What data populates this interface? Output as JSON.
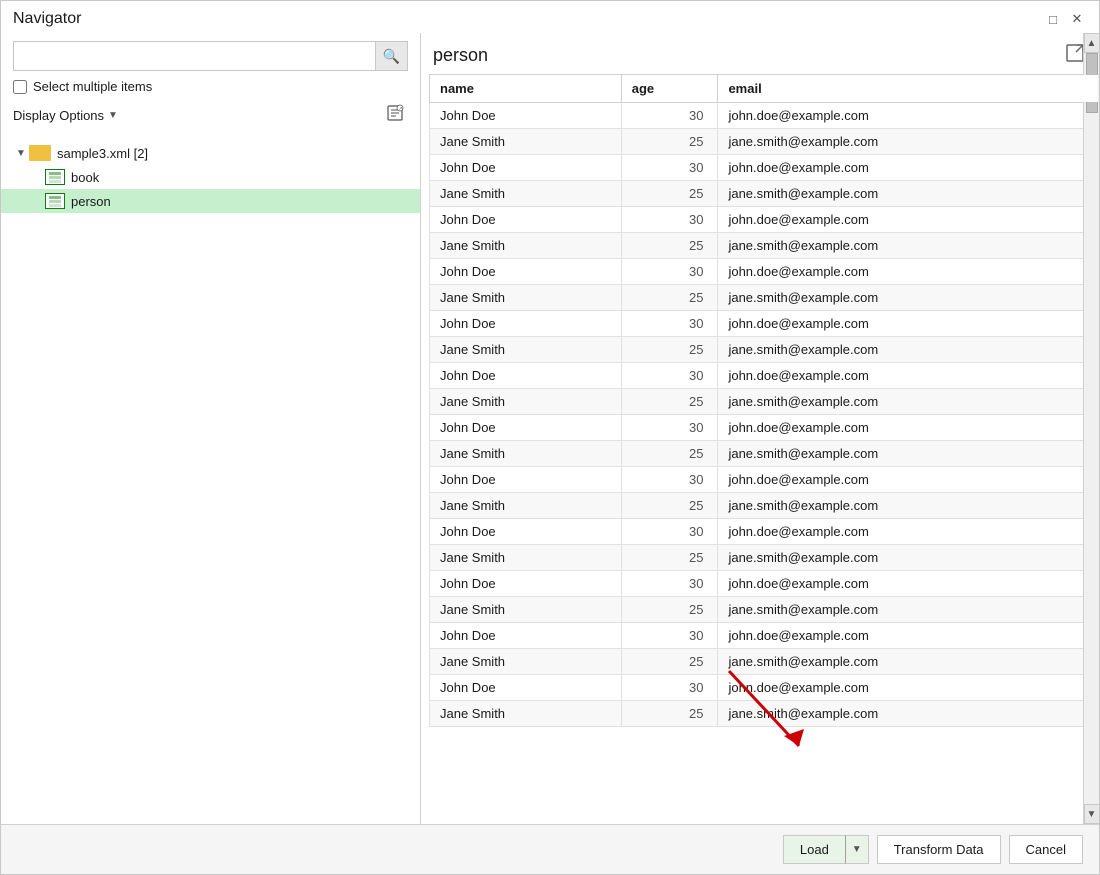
{
  "dialog": {
    "title": "Navigator",
    "minimize_label": "minimize",
    "close_label": "close"
  },
  "left_panel": {
    "search_placeholder": "",
    "select_multiple_label": "Select multiple items",
    "display_options_label": "Display Options",
    "tree": {
      "root": {
        "label": "sample3.xml [2]",
        "expanded": true,
        "children": [
          {
            "label": "book",
            "type": "table"
          },
          {
            "label": "person",
            "type": "table",
            "selected": true
          }
        ]
      }
    }
  },
  "right_panel": {
    "title": "person",
    "columns": [
      "name",
      "age",
      "email"
    ],
    "rows": [
      {
        "name": "John Doe",
        "age": "30",
        "email": "john.doe@example.com"
      },
      {
        "name": "Jane Smith",
        "age": "25",
        "email": "jane.smith@example.com"
      },
      {
        "name": "John Doe",
        "age": "30",
        "email": "john.doe@example.com"
      },
      {
        "name": "Jane Smith",
        "age": "25",
        "email": "jane.smith@example.com"
      },
      {
        "name": "John Doe",
        "age": "30",
        "email": "john.doe@example.com"
      },
      {
        "name": "Jane Smith",
        "age": "25",
        "email": "jane.smith@example.com"
      },
      {
        "name": "John Doe",
        "age": "30",
        "email": "john.doe@example.com"
      },
      {
        "name": "Jane Smith",
        "age": "25",
        "email": "jane.smith@example.com"
      },
      {
        "name": "John Doe",
        "age": "30",
        "email": "john.doe@example.com"
      },
      {
        "name": "Jane Smith",
        "age": "25",
        "email": "jane.smith@example.com"
      },
      {
        "name": "John Doe",
        "age": "30",
        "email": "john.doe@example.com"
      },
      {
        "name": "Jane Smith",
        "age": "25",
        "email": "jane.smith@example.com"
      },
      {
        "name": "John Doe",
        "age": "30",
        "email": "john.doe@example.com"
      },
      {
        "name": "Jane Smith",
        "age": "25",
        "email": "jane.smith@example.com"
      },
      {
        "name": "John Doe",
        "age": "30",
        "email": "john.doe@example.com"
      },
      {
        "name": "Jane Smith",
        "age": "25",
        "email": "jane.smith@example.com"
      },
      {
        "name": "John Doe",
        "age": "30",
        "email": "john.doe@example.com"
      },
      {
        "name": "Jane Smith",
        "age": "25",
        "email": "jane.smith@example.com"
      },
      {
        "name": "John Doe",
        "age": "30",
        "email": "john.doe@example.com"
      },
      {
        "name": "Jane Smith",
        "age": "25",
        "email": "jane.smith@example.com"
      },
      {
        "name": "John Doe",
        "age": "30",
        "email": "john.doe@example.com"
      },
      {
        "name": "Jane Smith",
        "age": "25",
        "email": "jane.smith@example.com"
      },
      {
        "name": "John Doe",
        "age": "30",
        "email": "john.doe@example.com"
      },
      {
        "name": "Jane Smith",
        "age": "25",
        "email": "jane.smith@example.com"
      }
    ]
  },
  "footer": {
    "load_label": "Load",
    "transform_label": "Transform Data",
    "cancel_label": "Cancel"
  }
}
